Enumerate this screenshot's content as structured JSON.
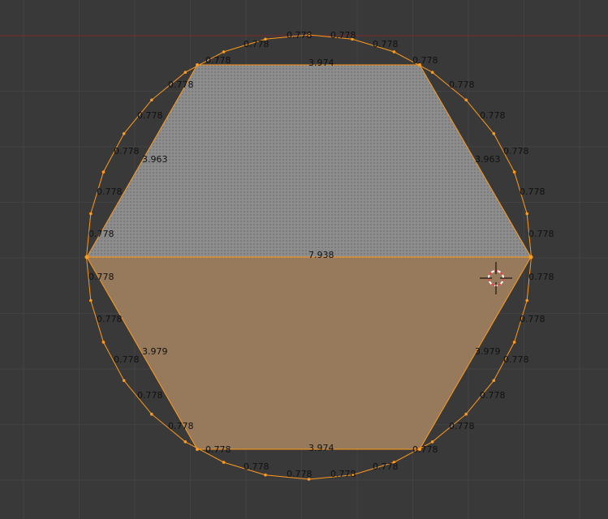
{
  "colors": {
    "background": "#393939",
    "grid": "#444444",
    "axis_x": "#8a2a2a",
    "edge": "#ff9a1c",
    "face_unselected": "#8c8c8c",
    "face_selected": "#967a5a",
    "label": "#111111",
    "cursor": "#000000",
    "cursor_ring": "#ff4444"
  },
  "labels": {
    "top_edge": "3.974",
    "mid_edge": "7.938",
    "bottom_edge": "3.974",
    "upper_left_edge": "3.963",
    "upper_right_edge": "3.963",
    "lower_left_edge": "3.979",
    "lower_right_edge": "3.979",
    "segment": "0.778"
  },
  "icons": {
    "cursor": "3d-cursor-icon"
  }
}
